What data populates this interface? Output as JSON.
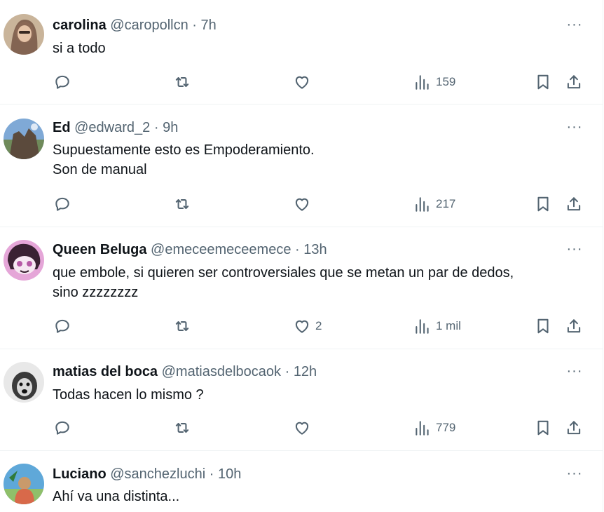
{
  "tweets": [
    {
      "name": "carolina",
      "handle": "@caropollcn",
      "sep": "·",
      "time": "7h",
      "lines": [
        "si a todo"
      ],
      "likes": "",
      "views": "159",
      "avatar_colors": [
        "#c9b49a",
        "#6b4a3a"
      ]
    },
    {
      "name": "Ed",
      "handle": "@edward_2",
      "sep": "·",
      "time": "9h",
      "lines": [
        "Supuestamente esto es Empoderamiento.",
        "Son de manual"
      ],
      "likes": "",
      "views": "217",
      "avatar_colors": [
        "#7fa9d6",
        "#5b4a3c"
      ]
    },
    {
      "name": "Queen Beluga",
      "handle": "@emeceemeceemece",
      "sep": "·",
      "time": "13h",
      "lines": [
        "que embole, si quieren ser controversiales que se metan un par de dedos,",
        "sino zzzzzzzz"
      ],
      "likes": "2",
      "views": "1 mil",
      "avatar_colors": [
        "#e5a6d8",
        "#3a2233"
      ]
    },
    {
      "name": "matias del boca",
      "handle": "@matiasdelbocaok",
      "sep": "·",
      "time": "12h",
      "lines": [
        "Todas hacen lo mismo ?"
      ],
      "likes": "",
      "views": "779",
      "avatar_colors": [
        "#e8e8e8",
        "#3a3a3a"
      ]
    },
    {
      "name": "Luciano",
      "handle": "@sanchezluchi",
      "sep": "·",
      "time": "10h",
      "lines": [
        "Ahí va una distinta..."
      ],
      "likes": "",
      "views": "",
      "avatar_colors": [
        "#5fa8d9",
        "#c99a6b"
      ]
    }
  ],
  "more_label": "···",
  "icons": {
    "reply": "reply-icon",
    "retweet": "retweet-icon",
    "like": "like-icon",
    "views": "views-icon",
    "bookmark": "bookmark-icon",
    "share": "share-icon",
    "more": "more-icon"
  },
  "colors": {
    "text": "#0f1419",
    "secondary": "#536471",
    "divider": "#eff3f4"
  }
}
